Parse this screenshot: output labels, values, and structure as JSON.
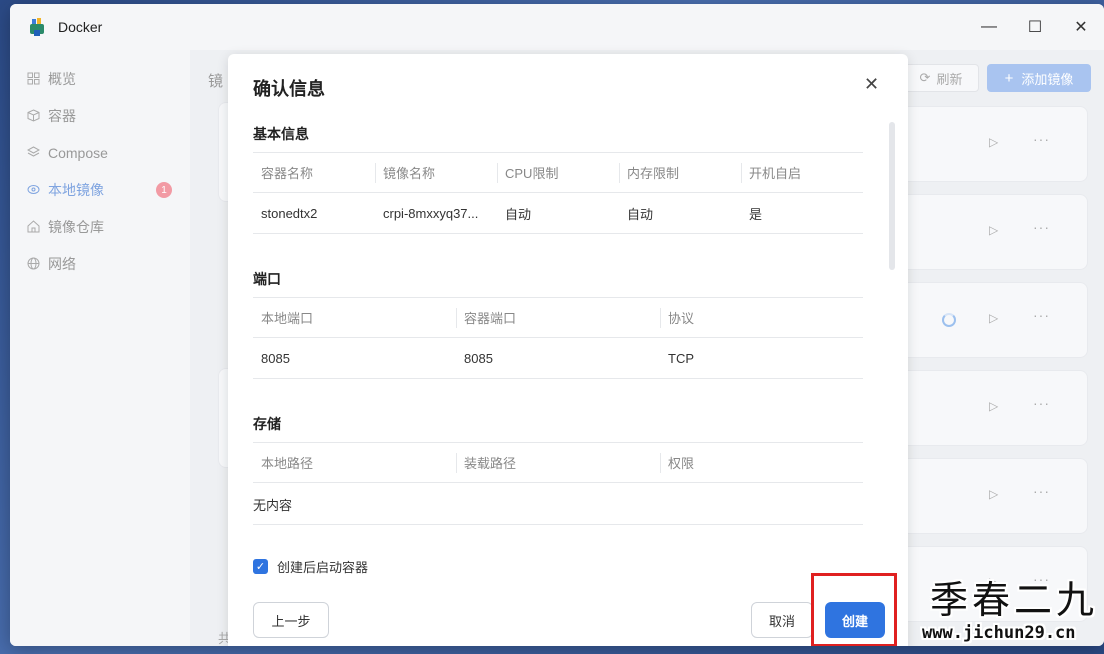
{
  "window": {
    "title": "Docker",
    "minimize_icon": "minimize-icon",
    "maximize_icon": "maximize-icon",
    "close_icon": "close-icon"
  },
  "sidebar": {
    "items": [
      {
        "label": "概览",
        "icon": "grid-icon"
      },
      {
        "label": "容器",
        "icon": "cube-icon"
      },
      {
        "label": "Compose",
        "icon": "layers-icon"
      },
      {
        "label": "本地镜像",
        "icon": "disk-icon",
        "badge": "1",
        "active": true
      },
      {
        "label": "镜像仓库",
        "icon": "home-icon"
      },
      {
        "label": "网络",
        "icon": "globe-icon"
      }
    ]
  },
  "main": {
    "title_partial": "镜",
    "refresh_label": "刷新",
    "add_image_label": "添加镜像",
    "footer_partial": "共"
  },
  "dialog": {
    "title": "确认信息",
    "basic": {
      "title": "基本信息",
      "headers": [
        "容器名称",
        "镜像名称",
        "CPU限制",
        "内存限制",
        "开机自启"
      ],
      "row": [
        "stonedtx2",
        "crpi-8mxxyq37...",
        "自动",
        "自动",
        "是"
      ]
    },
    "ports": {
      "title": "端口",
      "headers": [
        "本地端口",
        "容器端口",
        "协议"
      ],
      "row": [
        "8085",
        "8085",
        "TCP"
      ]
    },
    "storage": {
      "title": "存储",
      "headers": [
        "本地路径",
        "装载路径",
        "权限"
      ],
      "empty": "无内容"
    },
    "start_after_create": {
      "label": "创建后启动容器",
      "checked": true
    },
    "prev_label": "上一步",
    "cancel_label": "取消",
    "create_label": "创建"
  },
  "watermark": {
    "big": "季春二九",
    "url": "www.jichun29.cn"
  },
  "colors": {
    "accent": "#2f74e0",
    "highlight": "#e02020",
    "badge": "#f29aa4"
  }
}
